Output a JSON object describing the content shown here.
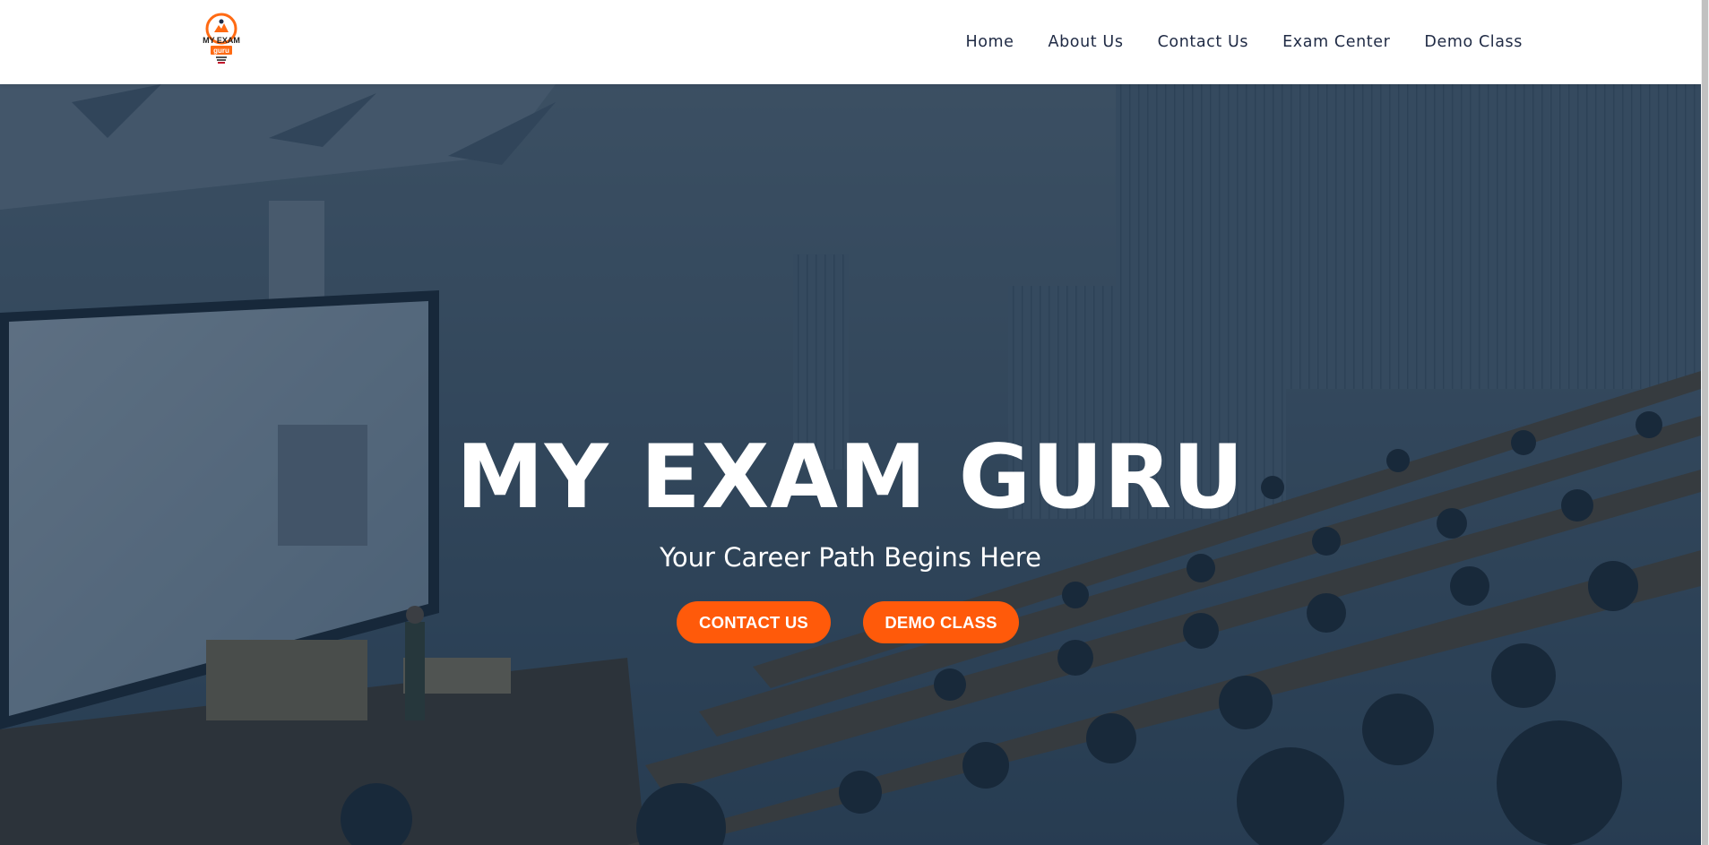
{
  "brand": {
    "logo_line1": "MY EXAM",
    "logo_line2": "guru",
    "logo_accent": "#ff6a13"
  },
  "nav": {
    "items": [
      {
        "label": "Home"
      },
      {
        "label": "About Us"
      },
      {
        "label": "Contact Us"
      },
      {
        "label": "Exam Center"
      },
      {
        "label": "Demo Class"
      }
    ]
  },
  "hero": {
    "title": "MY EXAM GURU",
    "subtitle": "Your Career Path Begins Here",
    "buttons": {
      "contact": "CONTACT US",
      "demo": "DEMO CLASS"
    },
    "button_color": "#ff5a0a"
  },
  "colors": {
    "nav_text": "#1f2a44",
    "overlay": "#14283e"
  }
}
